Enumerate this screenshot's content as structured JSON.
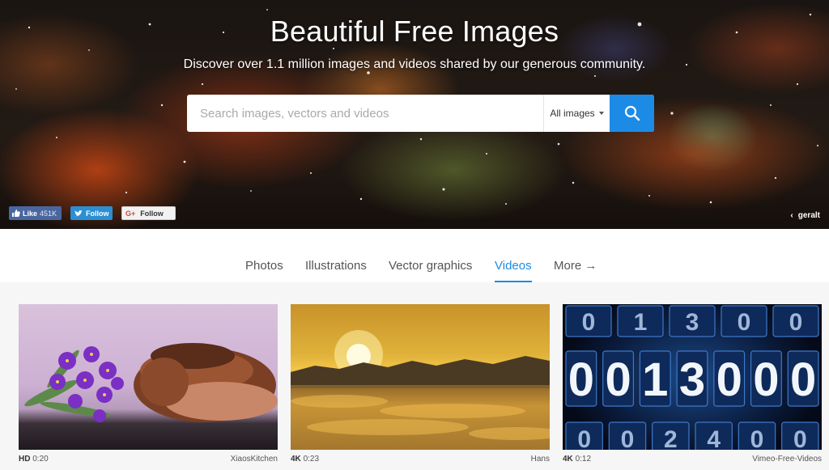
{
  "hero": {
    "title": "Beautiful Free Images",
    "subtitle": "Discover over 1.1 million images and videos shared by our generous community.",
    "search_placeholder": "Search images, vectors and videos",
    "search_type": "All images",
    "credit_arrow": "‹",
    "credit": "geralt"
  },
  "social": {
    "fb_label": "Like",
    "fb_count": "451K",
    "tw_label": "Follow",
    "gp_icon": "G+",
    "gp_label": "Follow"
  },
  "tabs": [
    {
      "label": "Photos"
    },
    {
      "label": "Illustrations"
    },
    {
      "label": "Vector graphics"
    },
    {
      "label": "Videos"
    },
    {
      "label": "More →"
    }
  ],
  "videos": [
    {
      "quality": "HD",
      "duration": "0:20",
      "author": "XiaosKitchen"
    },
    {
      "quality": "4K",
      "duration": "0:23",
      "author": "Hans"
    },
    {
      "quality": "4K",
      "duration": "0:12",
      "author": "Vimeo-Free-Videos"
    }
  ],
  "counter_rows": [
    [
      "0",
      "1",
      "3",
      "0",
      "0"
    ],
    [
      "0",
      "0",
      "1",
      "3",
      "0",
      "0",
      "0"
    ],
    [
      "0",
      "0",
      "2",
      "4",
      "0",
      "0"
    ]
  ],
  "colors": {
    "accent": "#1c8be6",
    "facebook": "#4a66a0",
    "twitter": "#2b8fd3"
  },
  "icons": {
    "search": "search-icon",
    "facebook": "thumbs-up-icon",
    "twitter": "twitter-bird-icon",
    "google": "google-plus-icon"
  }
}
